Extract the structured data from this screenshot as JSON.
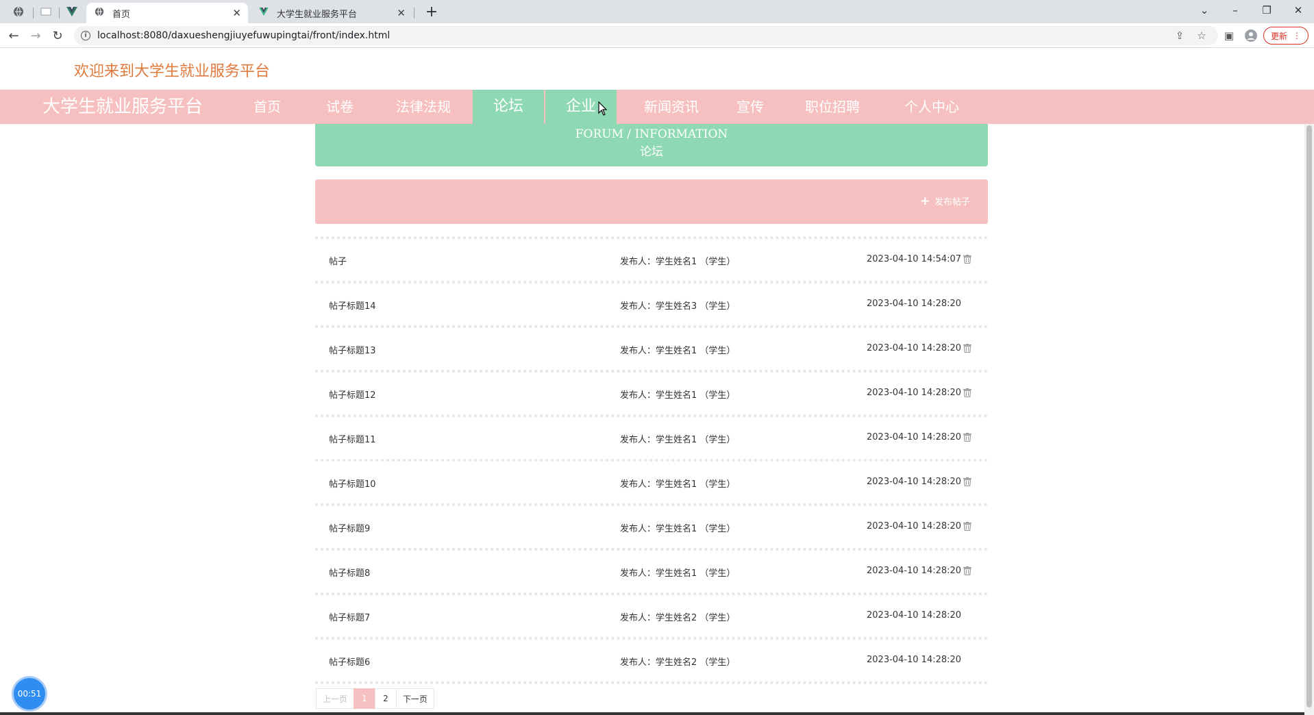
{
  "browser": {
    "tabs": [
      {
        "title": "首页",
        "active": true
      },
      {
        "title": "大学生就业服务平台",
        "active": false
      }
    ],
    "url": "localhost:8080/daxueshengjiuyefuwupingtai/front/index.html",
    "update_label": "更新"
  },
  "page": {
    "welcome": "欢迎来到大学生就业服务平台",
    "brand": "大学生就业服务平台",
    "nav": [
      "首页",
      "试卷",
      "法律法规",
      "论坛",
      "企业",
      "新闻资讯",
      "宣传",
      "职位招聘",
      "个人中心"
    ],
    "active_nav": "论坛",
    "banner": {
      "en": "FORUM / INFORMATION",
      "cn": "论坛"
    },
    "post_button": "发布帖子",
    "posts": [
      {
        "title": "帖子",
        "author": "发布人：学生姓名1 （学生）",
        "time": "2023-04-10 14:54:07",
        "deletable": true
      },
      {
        "title": "帖子标题14",
        "author": "发布人：学生姓名3 （学生）",
        "time": "2023-04-10 14:28:20",
        "deletable": false
      },
      {
        "title": "帖子标题13",
        "author": "发布人：学生姓名1 （学生）",
        "time": "2023-04-10 14:28:20",
        "deletable": true
      },
      {
        "title": "帖子标题12",
        "author": "发布人：学生姓名1 （学生）",
        "time": "2023-04-10 14:28:20",
        "deletable": true
      },
      {
        "title": "帖子标题11",
        "author": "发布人：学生姓名1 （学生）",
        "time": "2023-04-10 14:28:20",
        "deletable": true
      },
      {
        "title": "帖子标题10",
        "author": "发布人：学生姓名1 （学生）",
        "time": "2023-04-10 14:28:20",
        "deletable": true
      },
      {
        "title": "帖子标题9",
        "author": "发布人：学生姓名1 （学生）",
        "time": "2023-04-10 14:28:20",
        "deletable": true
      },
      {
        "title": "帖子标题8",
        "author": "发布人：学生姓名1 （学生）",
        "time": "2023-04-10 14:28:20",
        "deletable": true
      },
      {
        "title": "帖子标题7",
        "author": "发布人：学生姓名2 （学生）",
        "time": "2023-04-10 14:28:20",
        "deletable": false
      },
      {
        "title": "帖子标题6",
        "author": "发布人：学生姓名2 （学生）",
        "time": "2023-04-10 14:28:20",
        "deletable": false
      }
    ],
    "pagination": {
      "prev": "上一页",
      "pages": [
        "1",
        "2"
      ],
      "current": "1",
      "next": "下一页"
    },
    "timer": "00:51"
  },
  "colors": {
    "accent_pink": "#f7c0c0",
    "accent_green": "#8ed9b4",
    "welcome_orange": "#e07a3c"
  }
}
